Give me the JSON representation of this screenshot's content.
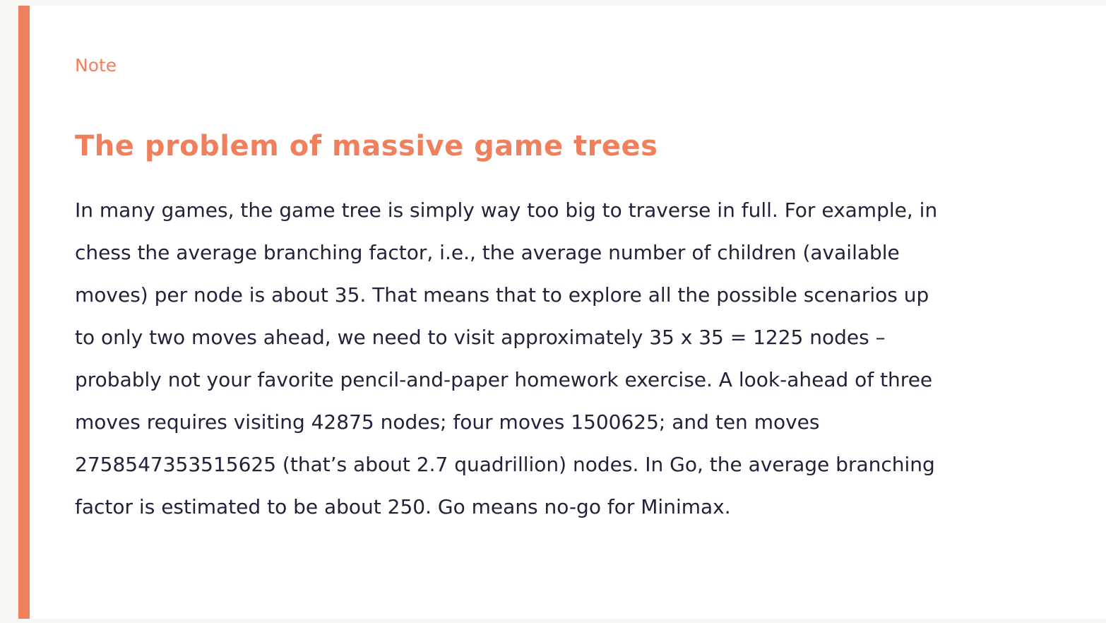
{
  "colors": {
    "accent": "#f0805d",
    "text": "#22223a",
    "background": "#ffffff",
    "page_background": "#f7f6f2"
  },
  "note": {
    "label": "Note",
    "title": "The problem of massive game trees",
    "body_lines": [
      "In many games, the game tree is simply way too big to traverse in full. For example, in",
      "chess the average branching factor, i.e., the average number of children (available",
      "moves) per node is about 35. That means that to explore all the possible scenarios up",
      "to only two moves ahead, we need to visit approximately 35 x 35 = 1225 nodes –",
      "probably not your favorite pencil-and-paper homework exercise. A look-ahead of three",
      "moves requires visiting 42875 nodes; four moves 1500625; and ten moves",
      "2758547353515625 (that’s about 2.7 quadrillion) nodes. In Go, the average branching",
      "factor is estimated to be about 250. Go means no-go for Minimax."
    ]
  }
}
